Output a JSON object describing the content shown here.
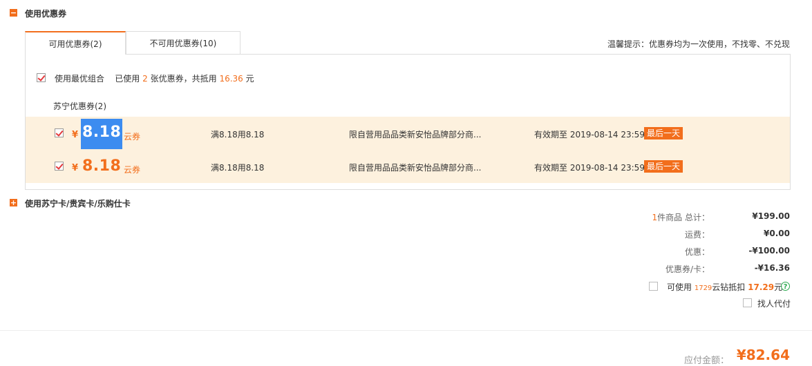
{
  "coupon_section": {
    "title": "使用优惠券",
    "toggle": "−",
    "tabs": [
      {
        "label": "可用优惠券(2)",
        "active": true
      },
      {
        "label": "不可用优惠券(10)",
        "active": false
      }
    ],
    "hint": "温馨提示：优惠券均为一次使用，不找零、不兑现",
    "best_combo": {
      "label": "使用最优组合",
      "used_prefix": "已使用",
      "used_count": "2",
      "used_mid": "张优惠券，共抵用",
      "used_amount": "16.36",
      "used_suffix": "元"
    },
    "group_title": "苏宁优惠券(2)",
    "coupons": [
      {
        "currency": "¥",
        "amount": "8.18",
        "type": "云券",
        "condition": "满8.18用8.18",
        "scope": "限自营用品品类新安怡品牌部分商...",
        "expiry": "有效期至 2019-08-14 23:59",
        "badge": "最后一天"
      },
      {
        "currency": "¥",
        "amount": "8.18",
        "type": "云券",
        "condition": "满8.18用8.18",
        "scope": "限自营用品品类新安怡品牌部分商...",
        "expiry": "有效期至 2019-08-14 23:59",
        "badge": "最后一天"
      }
    ]
  },
  "card_section": {
    "title": "使用苏宁卡/贵宾卡/乐购仕卡",
    "toggle": "+"
  },
  "summary": {
    "items_count": "1",
    "items_label": "件商品 总计：",
    "total": "¥199.00",
    "shipping_label": "运费：",
    "shipping": "¥0.00",
    "discount_label": "优惠：",
    "discount": "-¥100.00",
    "coupon_label": "优惠券/卡：",
    "coupon": "-¥16.36",
    "diamond_prefix": "可使用",
    "diamond_count": "1729",
    "diamond_mid": "云钻抵扣",
    "diamond_amount": "17.29",
    "diamond_suffix": "元",
    "help": "?",
    "proxy_pay": "找人代付",
    "payable_label": "应付金额：",
    "payable": "¥82.64"
  },
  "colors": {
    "accent": "#f26e1c",
    "row_bg": "#fdf1de",
    "check": "#e4393c",
    "help": "#29a84d"
  }
}
